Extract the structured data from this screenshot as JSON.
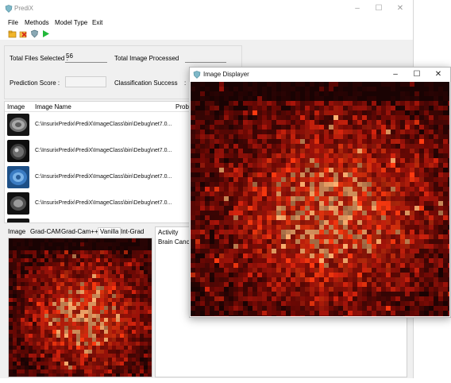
{
  "window": {
    "title": "PrediX",
    "controls": [
      "–",
      "☐",
      "✕"
    ]
  },
  "menu": {
    "items": [
      "File",
      "Methods",
      "Model Type",
      "Exit"
    ]
  },
  "toolbar": {
    "icons": [
      "open-folder-icon",
      "delete-icon",
      "shield-icon",
      "run-icon"
    ]
  },
  "stats": {
    "total_files_label": "Total Files Selected  :",
    "total_files_value": "56",
    "total_processed_label": "Total Image Processed",
    "prediction_label": "Prediction Score    :",
    "classification_label": "Classification Success",
    "classification_colon": ":"
  },
  "table": {
    "columns": [
      "Image",
      "Image Name",
      "Proba"
    ],
    "rows": [
      {
        "path": "C:\\InsurixPredix\\PrediX\\ImageClass\\bin\\Debug\\net7.0...",
        "thumb": "ct-gray"
      },
      {
        "path": "C:\\InsurixPredix\\PrediX\\ImageClass\\bin\\Debug\\net7.0...",
        "thumb": "ct-dark"
      },
      {
        "path": "C:\\InsurixPredix\\PrediX\\ImageClass\\bin\\Debug\\net7.0...",
        "thumb": "ct-blue"
      },
      {
        "path": "C:\\InsurixPredix\\PrediX\\ImageClass\\bin\\Debug\\net7.0...",
        "thumb": "ct-gray2"
      }
    ]
  },
  "tabs": {
    "items": [
      "Image",
      "Grad-CAM",
      "Grad-Cam++",
      "Vanilla",
      "Int-Grad"
    ],
    "active": "Vanilla"
  },
  "activity": {
    "header": "Activity",
    "entry": "Brain Cancer"
  },
  "displayer": {
    "title": "Image Displayer",
    "controls": [
      "–",
      "☐",
      "✕"
    ]
  },
  "colors": {
    "heat_dark": "#1a0303",
    "heat_mid": "#7a0a05",
    "heat_hot": "#ff3a10",
    "heat_peak": "#ffb070"
  }
}
